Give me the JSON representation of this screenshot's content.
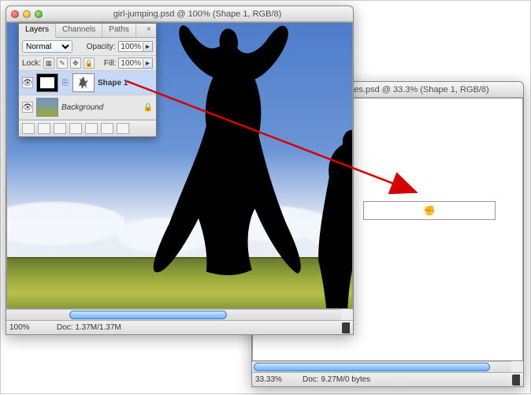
{
  "windowA": {
    "title": "girl-jumping.psd @ 100% (Shape 1, RGB/8)",
    "zoom": "100%",
    "docinfo": "Doc: 1.37M/1.37M"
  },
  "windowB": {
    "title": "silhouettes.psd @ 33.3% (Shape 1, RGB/8)",
    "zoom": "33.33%",
    "docinfo": "Doc: 9.27M/0 bytes"
  },
  "layersPanel": {
    "tabs": {
      "layers": "Layers",
      "channels": "Channels",
      "paths": "Paths"
    },
    "blend_label": "Normal",
    "opacity_label": "Opacity:",
    "opacity_value": "100%",
    "lock_label": "Lock:",
    "fill_label": "Fill:",
    "fill_value": "100%",
    "layers": [
      {
        "name": "Shape 1"
      },
      {
        "name": "Background"
      }
    ]
  },
  "drag_ghost_symbol": "✊"
}
